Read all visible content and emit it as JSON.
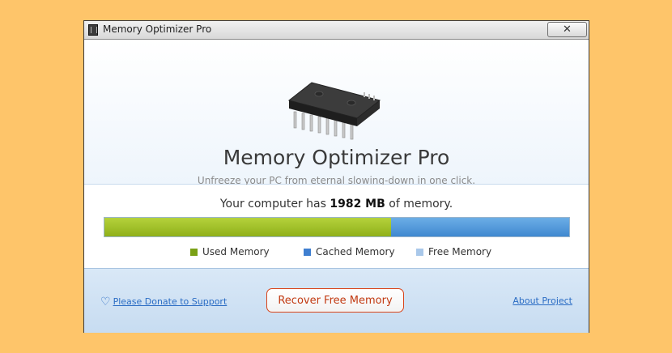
{
  "window": {
    "title": "Memory Optimizer Pro",
    "close_label": "✕"
  },
  "hero": {
    "app_name": "Memory Optimizer Pro",
    "tagline": "Unfreeze your PC from eternal slowing-down in one click.",
    "icon": "ram-chip-icon"
  },
  "memory": {
    "prefix": "Your computer has",
    "total": "1982 MB",
    "suffix": "of memory.",
    "used_fraction": 0.617,
    "cached_fraction": 0.383,
    "free_fraction": 0.0,
    "legend": {
      "used": "Used Memory",
      "cached": "Cached Memory",
      "free": "Free Memory"
    },
    "colors": {
      "used": "#8fb01a",
      "cached": "#3f88d0",
      "free": "#a5c7e8"
    }
  },
  "footer": {
    "donate_label": "Please Donate to Support",
    "donate_icon": "heart-icon",
    "recover_label": "Recover Free Memory",
    "about_label": "About Project"
  }
}
